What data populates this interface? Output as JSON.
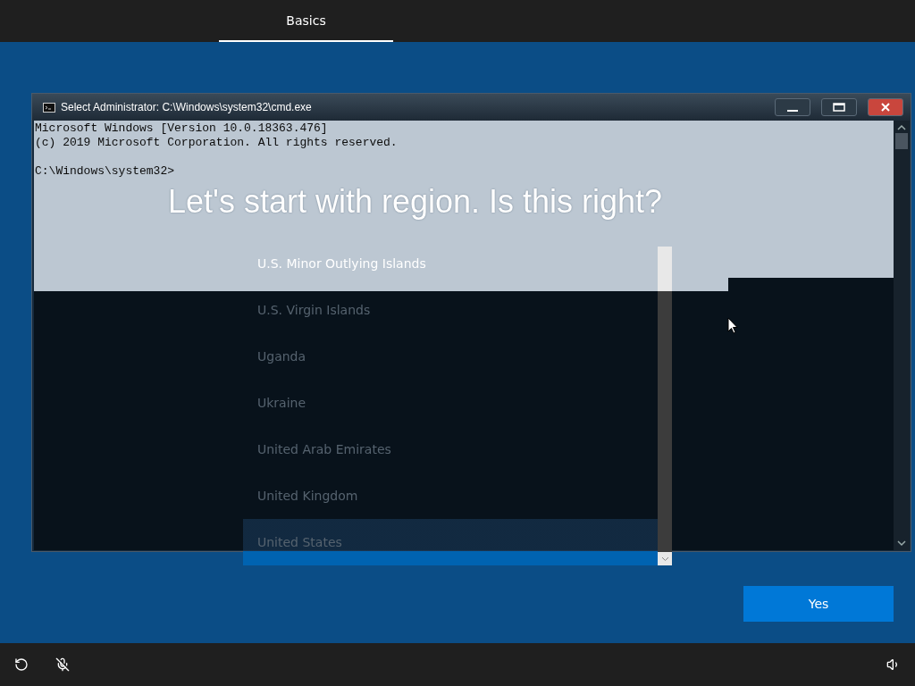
{
  "top_bar": {
    "tabs": [
      {
        "label": "Basics",
        "selected": true
      }
    ]
  },
  "page": {
    "heading": "Let's start with region. Is this right?",
    "regions": [
      {
        "label": "U.S. Minor Outlying Islands",
        "selected": false
      },
      {
        "label": "U.S. Virgin Islands",
        "selected": false
      },
      {
        "label": "Uganda",
        "selected": false
      },
      {
        "label": "Ukraine",
        "selected": false
      },
      {
        "label": "United Arab Emirates",
        "selected": false
      },
      {
        "label": "United Kingdom",
        "selected": false
      },
      {
        "label": "United States",
        "selected": true
      }
    ],
    "button": "Yes"
  },
  "console_window": {
    "title": "Select Administrator: C:\\Windows\\system32\\cmd.exe",
    "output": [
      "Microsoft Windows [Version 10.0.18363.476]",
      "(c) 2019 Microsoft Corporation. All rights reserved."
    ],
    "prompt": "C:\\Windows\\system32>"
  }
}
